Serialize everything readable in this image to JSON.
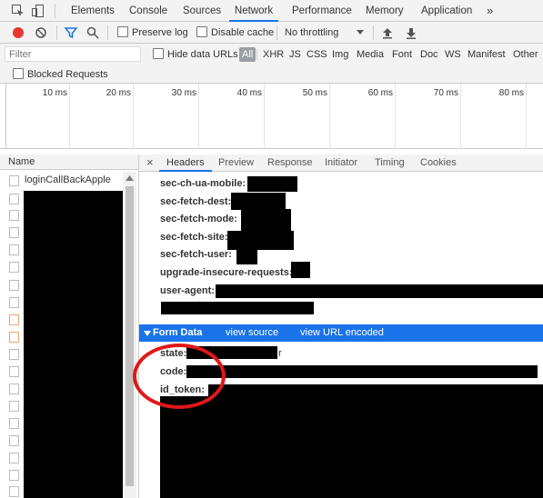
{
  "tabs": [
    "Elements",
    "Console",
    "Sources",
    "Network",
    "Performance",
    "Memory",
    "Application"
  ],
  "more_tabs": "»",
  "toolbar": {
    "preserve_log": "Preserve log",
    "disable_cache": "Disable cache",
    "throttling": "No throttling"
  },
  "filter": {
    "placeholder": "Filter",
    "hide_data_urls": "Hide data URLs",
    "types": [
      "All",
      "XHR",
      "JS",
      "CSS",
      "Img",
      "Media",
      "Font",
      "Doc",
      "WS",
      "Manifest",
      "Other"
    ]
  },
  "blocked_requests": "Blocked Requests",
  "timeline_ticks": [
    "10 ms",
    "20 ms",
    "30 ms",
    "40 ms",
    "50 ms",
    "60 ms",
    "70 ms",
    "80 ms"
  ],
  "request_list": {
    "header": "Name",
    "first_item": "loginCallBackApple"
  },
  "detail_tabs": [
    "Headers",
    "Preview",
    "Response",
    "Initiator",
    "Timing",
    "Cookies"
  ],
  "close_glyph": "×",
  "headers": [
    "sec-ch-ua-mobile:",
    "sec-fetch-dest:",
    "sec-fetch-mode:",
    "sec-fetch-site:",
    "sec-fetch-user:",
    "upgrade-insecure-requests:",
    "user-agent:"
  ],
  "form_data": {
    "title": "Form Data",
    "view_source": "view source",
    "view_url_encoded": "view URL encoded",
    "fields": [
      "state:",
      "code:",
      "id_token:"
    ],
    "state_tail": "r"
  },
  "colors": {
    "accent": "#1a73e8",
    "record": "#e8372e",
    "annotation": "#e01818"
  },
  "icons": [
    "inspect-icon",
    "device-toolbar-icon",
    "record-icon",
    "clear-icon",
    "filter-icon",
    "search-icon",
    "dropdown-icon",
    "import-har-icon",
    "export-har-icon"
  ]
}
